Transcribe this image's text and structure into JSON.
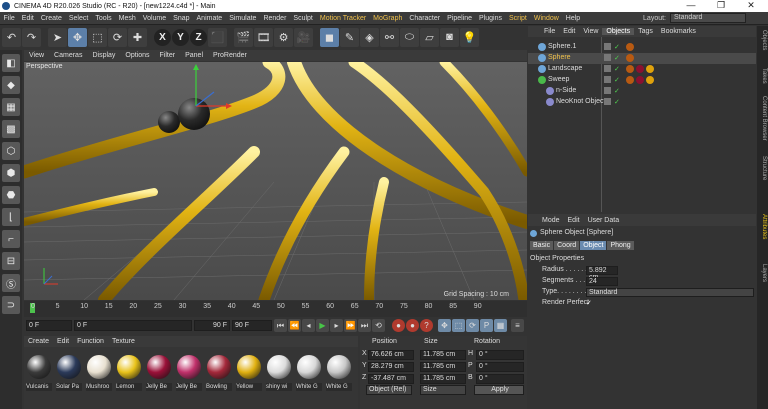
{
  "window": {
    "title": "CINEMA 4D R20.026 Studio (RC - R20) - [new1224.c4d *] - Main",
    "minimize": "—",
    "maximize": "❐",
    "close": "✕"
  },
  "menubar": {
    "items": [
      "File",
      "Edit",
      "Create",
      "Select",
      "Tools",
      "Mesh",
      "Volume",
      "Snap",
      "Animate",
      "Simulate",
      "Render",
      "Sculpt",
      "Motion Tracker",
      "MoGraph",
      "Character",
      "Pipeline",
      "Plugins",
      "Script",
      "Window",
      "Help"
    ],
    "layout_label": "Layout:",
    "layout_value": "Standard"
  },
  "toolbar": {
    "axis_x": "X",
    "axis_y": "Y",
    "axis_z": "Z"
  },
  "viewport": {
    "menu": [
      "View",
      "Cameras",
      "Display",
      "Options",
      "Filter",
      "Panel",
      "ProRender"
    ],
    "camera_label": "Perspective",
    "grid_spacing": "Grid Spacing : 10 cm"
  },
  "timeline": {
    "ticks": [
      "0",
      "5",
      "10",
      "15",
      "20",
      "25",
      "30",
      "35",
      "40",
      "45",
      "50",
      "55",
      "60",
      "65",
      "70",
      "75",
      "80",
      "85",
      "90"
    ],
    "current_frame": "0 F",
    "start_frame": "0 F",
    "preview_end": "90 F",
    "end_frame": "90 F",
    "right_label": "0 F"
  },
  "materials": {
    "menu": [
      "Create",
      "Edit",
      "Function",
      "Texture"
    ],
    "items": [
      {
        "name": "Vulcanis",
        "color": "#3a3a3a"
      },
      {
        "name": "Solar Pa",
        "color": "#2b3a5a"
      },
      {
        "name": "Mushroo",
        "color": "#e8e0d0"
      },
      {
        "name": "Lemon",
        "color": "#e8c21a"
      },
      {
        "name": "Jelly Be",
        "color": "#9a1038"
      },
      {
        "name": "Jelly Be",
        "color": "#c0306a"
      },
      {
        "name": "Bowling",
        "color": "#a4283a"
      },
      {
        "name": "Yellow",
        "color": "#e0b010"
      },
      {
        "name": "shiny wi",
        "color": "#dcdcdc"
      },
      {
        "name": "White G",
        "color": "#d8d8d8"
      },
      {
        "name": "White G",
        "color": "#c8c8c8"
      }
    ]
  },
  "coordinates": {
    "headers": [
      "Position",
      "Size",
      "Rotation"
    ],
    "rows": [
      {
        "axis": "X",
        "pos": "76.626 cm",
        "size": "11.785 cm",
        "rot_label": "H",
        "rot": "0 °"
      },
      {
        "axis": "Y",
        "pos": "28.279 cm",
        "size": "11.785 cm",
        "rot_label": "P",
        "rot": "0 °"
      },
      {
        "axis": "Z",
        "pos": "-37.487 cm",
        "size": "11.785 cm",
        "rot_label": "B",
        "rot": "0 °"
      }
    ],
    "mode": "Object (Rel)",
    "size_mode": "Size",
    "apply": "Apply"
  },
  "objects": {
    "tabs": [
      "File",
      "Edit",
      "View",
      "Objects",
      "Tags",
      "Bookmarks"
    ],
    "active_tab": "Objects",
    "rows": [
      {
        "name": "Sphere.1",
        "indent": 0,
        "icon_color": "#6ea6d8",
        "selected": false,
        "tags": [
          "#b85a12"
        ]
      },
      {
        "name": "Sphere",
        "indent": 0,
        "icon_color": "#6ea6d8",
        "selected": true,
        "tags": [
          "#b85a12"
        ]
      },
      {
        "name": "Landscape",
        "indent": 0,
        "icon_color": "#6ea6d8",
        "selected": false,
        "tags": [
          "#b85a12",
          "#8a1030",
          "#e0a20c"
        ]
      },
      {
        "name": "Sweep",
        "indent": 0,
        "icon_color": "#4ab84a",
        "selected": false,
        "tags": [
          "#b85a12",
          "#8a1030",
          "#e0a20c"
        ]
      },
      {
        "name": "n-Side",
        "indent": 1,
        "icon_color": "#8a8acd",
        "selected": false,
        "tags": []
      },
      {
        "name": "NeoKnot Object",
        "indent": 1,
        "icon_color": "#8a8acd",
        "selected": false,
        "tags": []
      }
    ]
  },
  "attributes": {
    "menu": [
      "Mode",
      "Edit",
      "User Data"
    ],
    "object_title": "Sphere Object [Sphere]",
    "tabs": [
      "Basic",
      "Coord",
      "Object",
      "Phong"
    ],
    "active_tab": "Object",
    "section": "Object Properties",
    "radius_label": "Radius . . . . . . .",
    "radius_value": "5.892 cm",
    "segments_label": "Segments . . . . .",
    "segments_value": "24",
    "type_label": "Type. . . . . . . . . .",
    "type_value": "Standard",
    "render_perfect_label": "Render Perfect",
    "render_perfect_check": "✓"
  },
  "side_tabs": [
    "Objects",
    "Takes",
    "Content Browser",
    "Structure",
    "Attributes",
    "Layers"
  ],
  "colors": {
    "accent": "#5c7fa8",
    "menu_highlight": "#f0c14b",
    "tube_gold": "#d4a80e"
  }
}
